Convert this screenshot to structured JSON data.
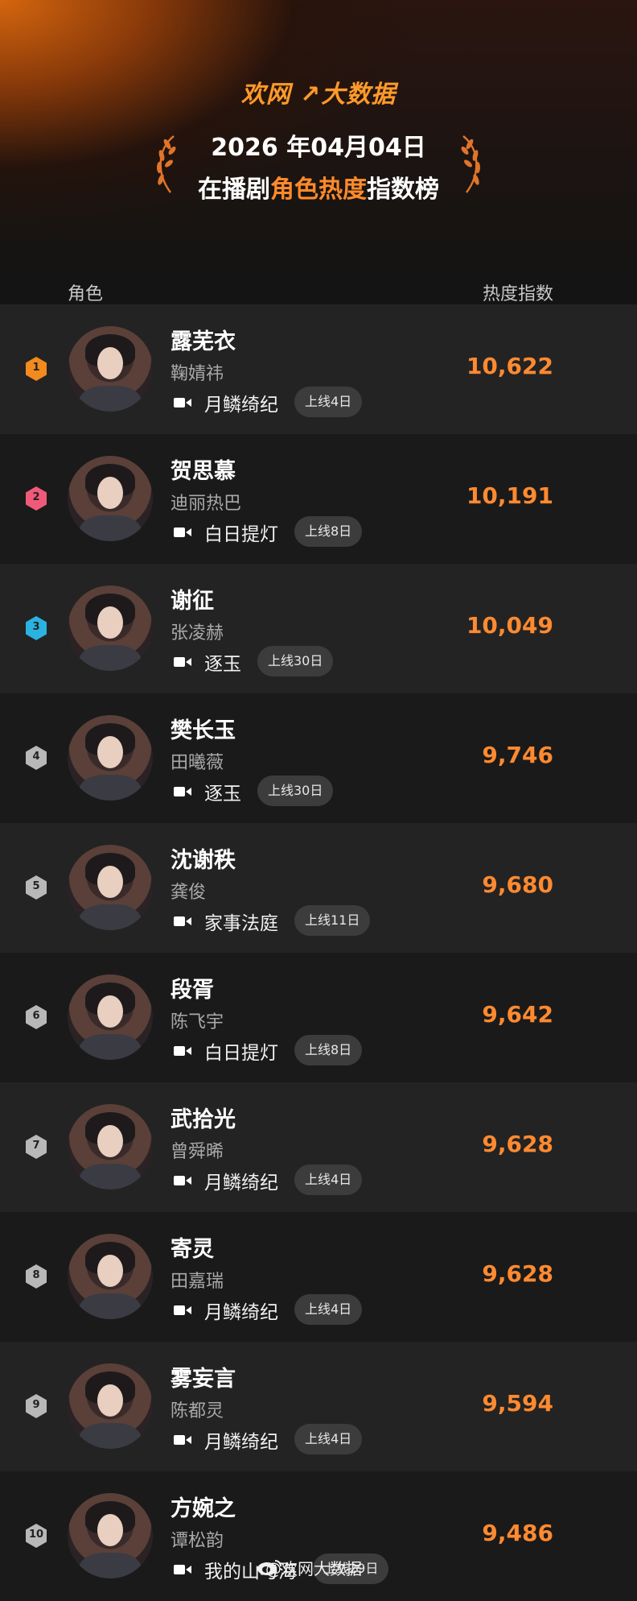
{
  "header": {
    "brand": "欢网 ↗大数据",
    "date": "2026 年04月04日",
    "title_prefix": "在播剧",
    "title_highlight": "角色热度",
    "title_suffix": "指数榜"
  },
  "columns": {
    "role": "角色",
    "heat": "热度指数"
  },
  "rank_colors": {
    "1": "#f28a1e",
    "2": "#f05a7a",
    "3": "#2ab3e0",
    "other": "#b8b8b8"
  },
  "rows": [
    {
      "rank": "1",
      "name": "露芜衣",
      "actor": "鞠婧祎",
      "drama": "月鳞绮纪",
      "days": "上线4日",
      "score": "10,622"
    },
    {
      "rank": "2",
      "name": "贺思慕",
      "actor": "迪丽热巴",
      "drama": "白日提灯",
      "days": "上线8日",
      "score": "10,191"
    },
    {
      "rank": "3",
      "name": "谢征",
      "actor": "张凌赫",
      "drama": "逐玉",
      "days": "上线30日",
      "score": "10,049"
    },
    {
      "rank": "4",
      "name": "樊长玉",
      "actor": "田曦薇",
      "drama": "逐玉",
      "days": "上线30日",
      "score": "9,746"
    },
    {
      "rank": "5",
      "name": "沈谢秩",
      "actor": "龚俊",
      "drama": "家事法庭",
      "days": "上线11日",
      "score": "9,680"
    },
    {
      "rank": "6",
      "name": "段胥",
      "actor": "陈飞宇",
      "drama": "白日提灯",
      "days": "上线8日",
      "score": "9,642"
    },
    {
      "rank": "7",
      "name": "武拾光",
      "actor": "曾舜晞",
      "drama": "月鳞绮纪",
      "days": "上线4日",
      "score": "9,628"
    },
    {
      "rank": "8",
      "name": "寄灵",
      "actor": "田嘉瑞",
      "drama": "月鳞绮纪",
      "days": "上线4日",
      "score": "9,628"
    },
    {
      "rank": "9",
      "name": "雾妄言",
      "actor": "陈都灵",
      "drama": "月鳞绮纪",
      "days": "上线4日",
      "score": "9,594"
    },
    {
      "rank": "10",
      "name": "方婉之",
      "actor": "谭松韵",
      "drama": "我的山与海",
      "days": "上线29日",
      "score": "9,486"
    }
  ],
  "watermark": "@欢网大数据"
}
